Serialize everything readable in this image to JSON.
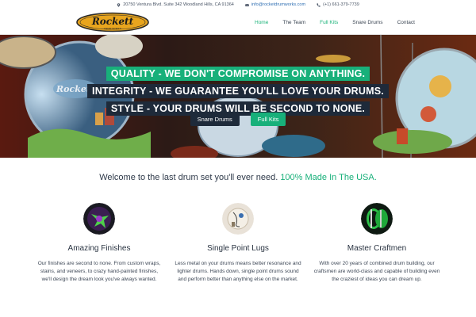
{
  "topbar": {
    "address": "20750 Ventura Blvd. Suite 342 Woodland Hills, CA 91364",
    "email": "info@rocketdrumworks.com",
    "phone": "(+1) 661-379-7739"
  },
  "brand": {
    "logo_text": "Rockett",
    "logo_tagline": "DRUM WORKS"
  },
  "nav": {
    "items": [
      {
        "label": "Home",
        "active": true
      },
      {
        "label": "The Team",
        "active": false
      },
      {
        "label": "Full Kits",
        "active": false
      },
      {
        "label": "Snare Drums",
        "active": false
      },
      {
        "label": "Contact",
        "active": false
      }
    ]
  },
  "hero": {
    "line1": "QUALITY - WE DON'T COMPROMISE ON ANYTHING.",
    "line2": "INTEGRITY - WE GUARANTEE YOU'LL LOVE YOUR DRUMS.",
    "line3": "STYLE - YOUR DRUMS WILL BE SECOND TO NONE.",
    "button_snare": "Snare Drums",
    "button_full": "Full Kits",
    "drum_logo": "Rockett"
  },
  "welcome": {
    "text": "Welcome to the last drum set you'll ever need.",
    "accent": "100% Made In The USA."
  },
  "features": [
    {
      "title": "Amazing Finishes",
      "desc": "Our finishes are second to none. From custom wraps, stains, and veneers, to crazy hand-painted finishes, we'll design the dream look you've always wanted."
    },
    {
      "title": "Single Point Lugs",
      "desc": "Less metal on your drums means better resonance and lighter drums. Hands down, single point drums sound and perform better than anything else on the market."
    },
    {
      "title": "Master Craftmen",
      "desc": "With over 20 years of combined drum building, our craftsmen are world-class and capable of building even the craziest of ideas you can dream up."
    }
  ],
  "colors": {
    "accent": "#18b07a",
    "dark": "#1e2a3a",
    "text": "#2f3a4a"
  }
}
